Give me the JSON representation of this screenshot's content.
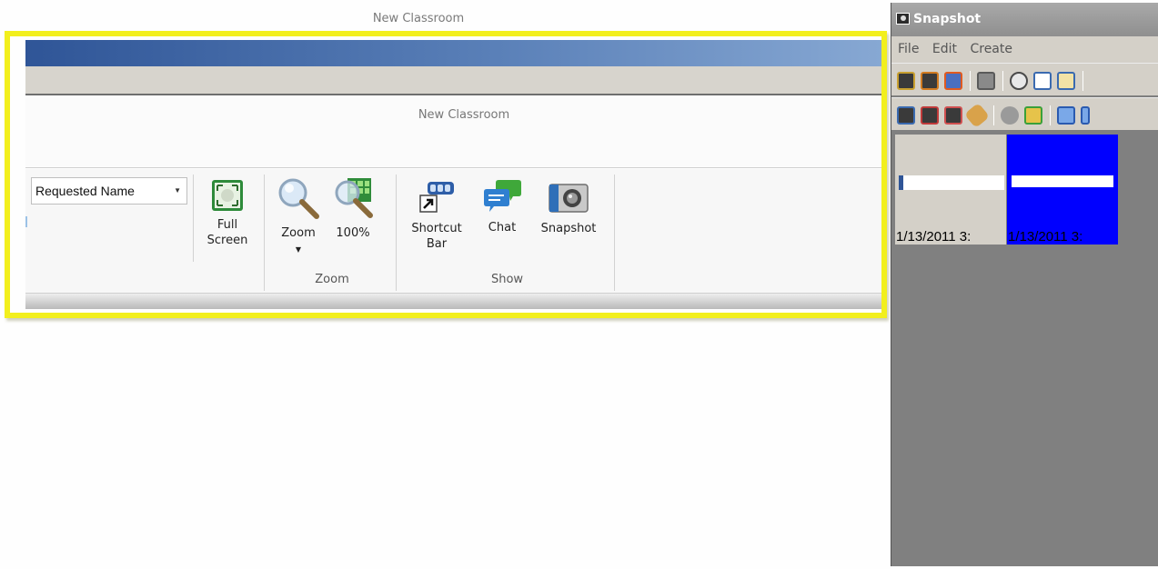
{
  "app": {
    "window_title": "New Classroom",
    "inner_title": "New Classroom"
  },
  "ribbon": {
    "name_dropdown": {
      "value": "Requested Name"
    },
    "buttons": {
      "full_screen": "Full Screen",
      "zoom": "Zoom",
      "zoom_100": "100%",
      "shortcut_bar": "Shortcut Bar",
      "chat": "Chat",
      "snapshot": "Snapshot"
    },
    "groups": {
      "zoom": "Zoom",
      "show": "Show"
    }
  },
  "snapshot_window": {
    "title": "Snapshot",
    "menu": [
      "File",
      "Edit",
      "Create"
    ],
    "thumbnails": [
      {
        "caption": "1/13/2011  3:",
        "selected": false
      },
      {
        "caption": "1/13/2011  3:",
        "selected": true
      }
    ]
  },
  "colors": {
    "highlight_border": "#f2ef1d",
    "title_bar_blue": "#2f5597",
    "selected_thumb": "#0000ff"
  }
}
